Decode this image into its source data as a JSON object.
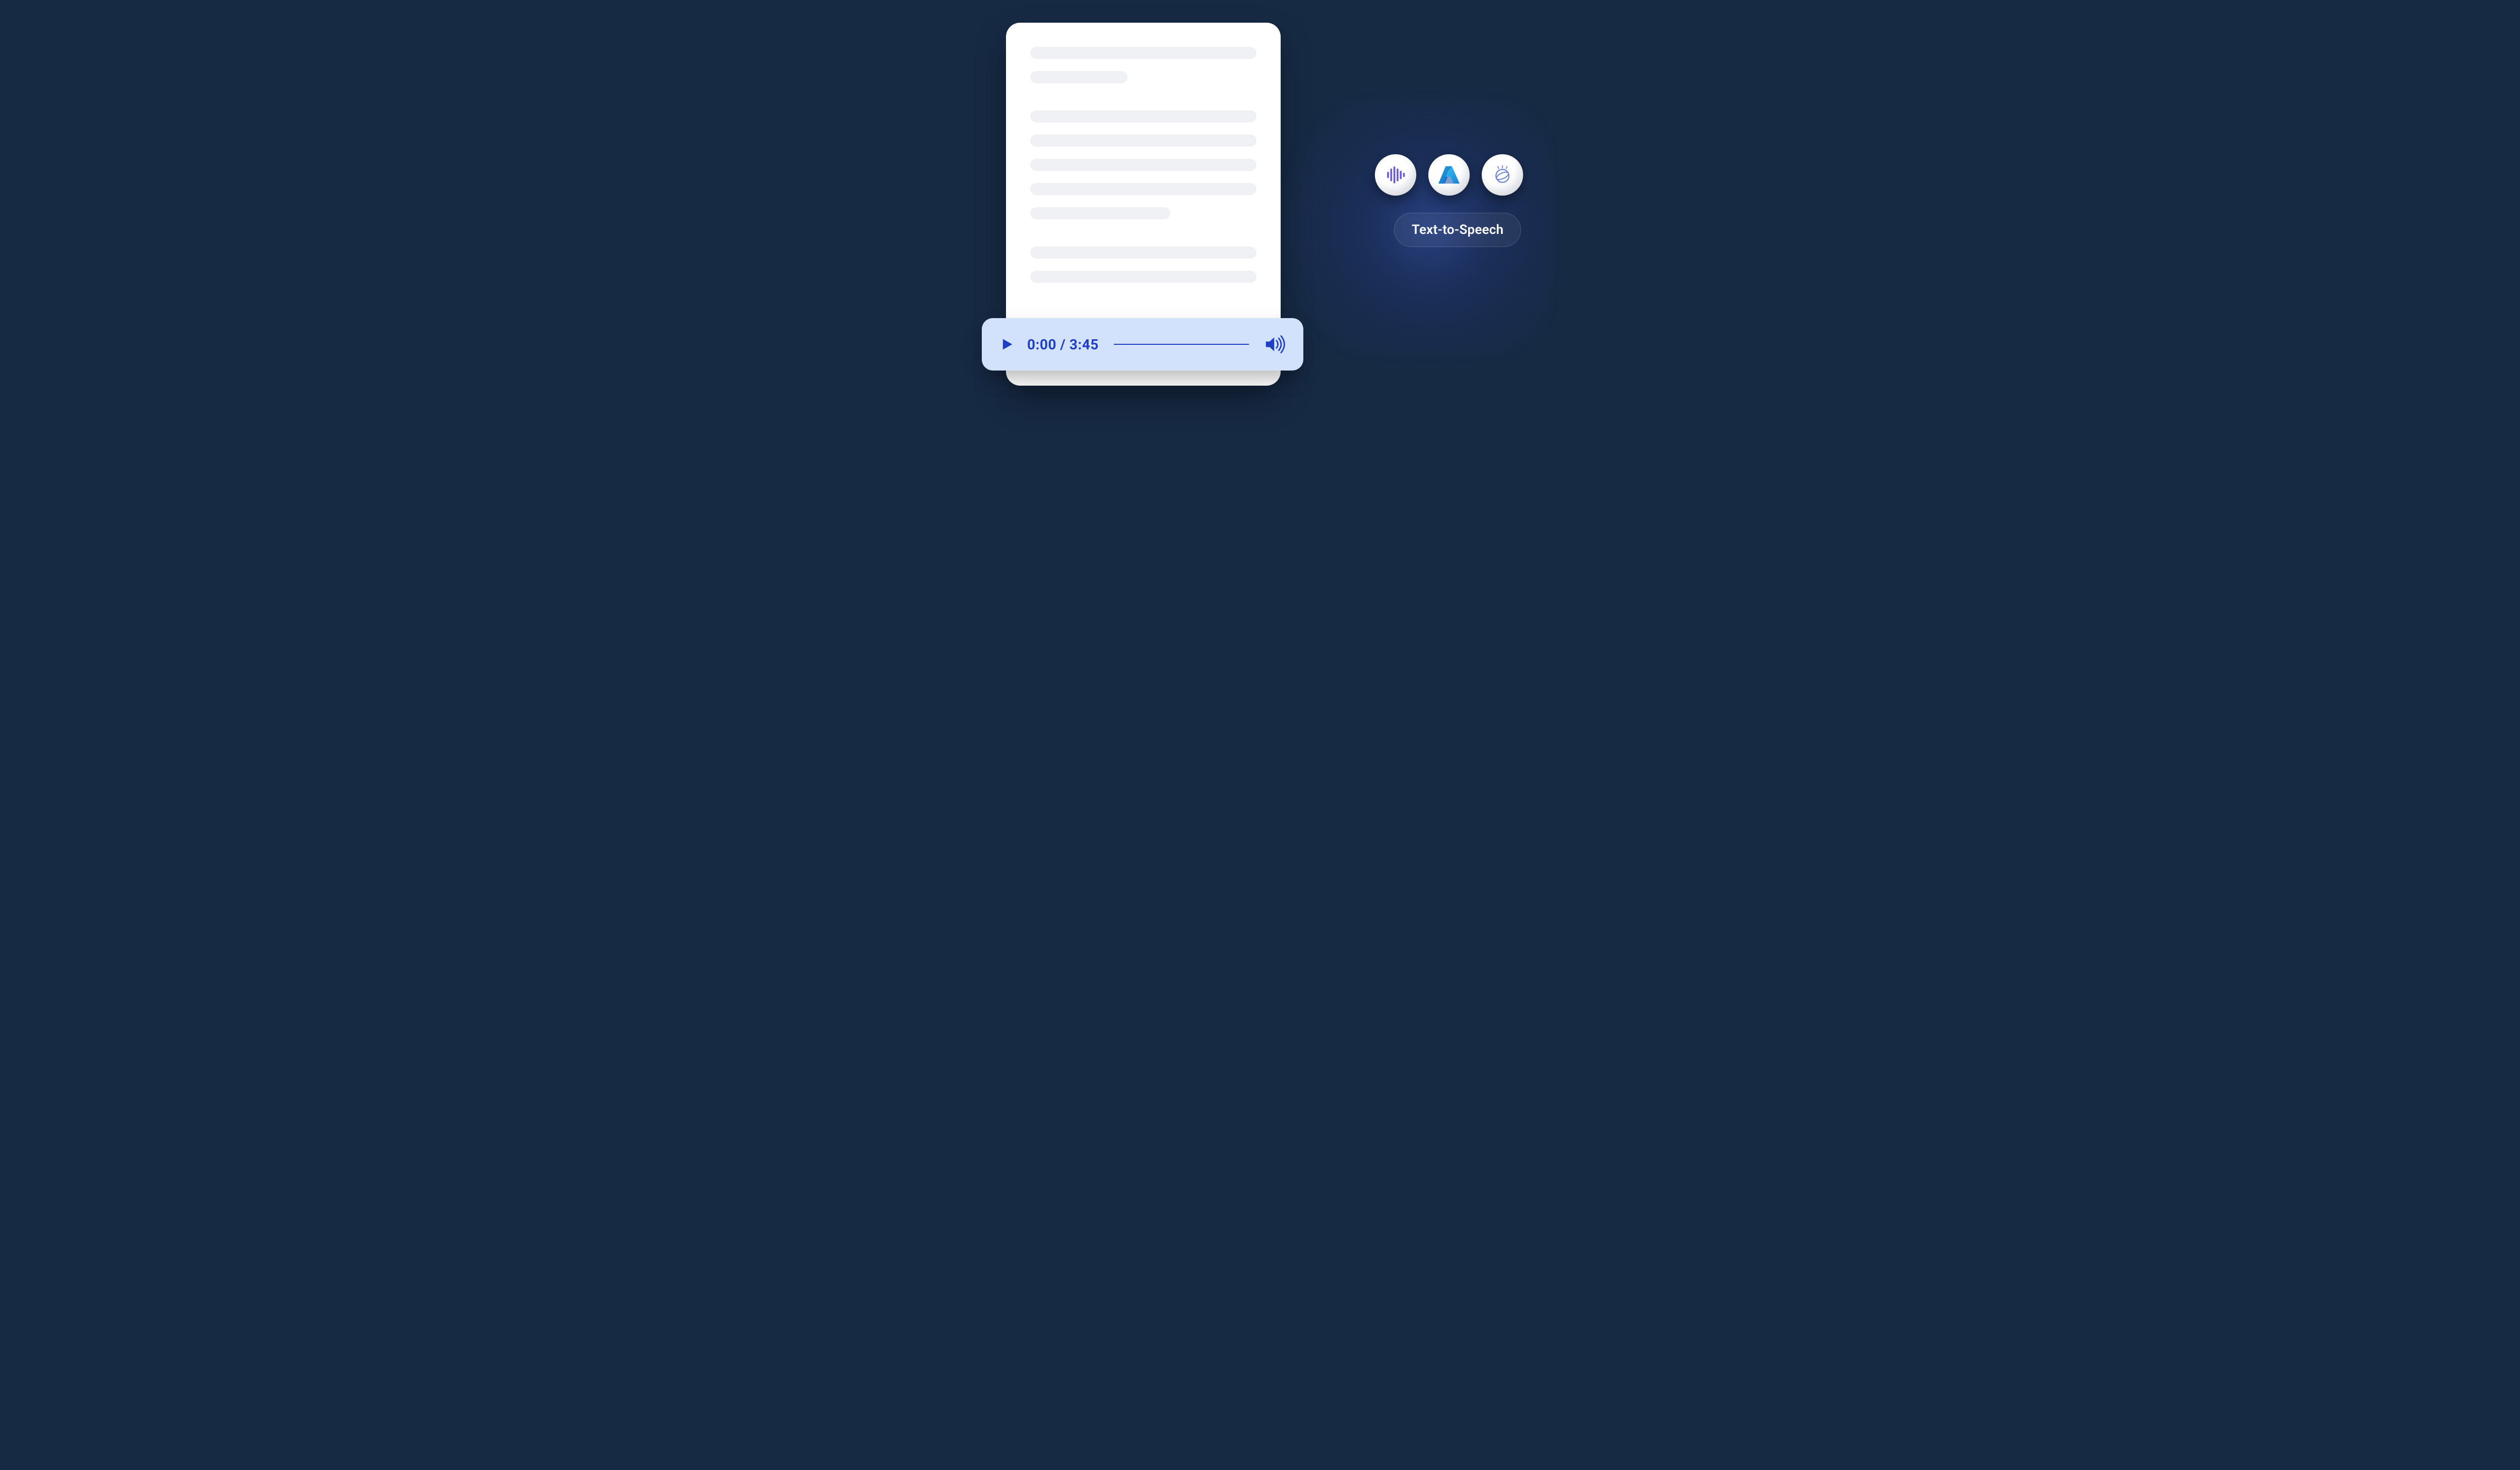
{
  "badge": {
    "label": "Text-to-Speech"
  },
  "player": {
    "current_time": "0:00",
    "separator": " / ",
    "total_time": "3:45"
  },
  "services": [
    {
      "name": "waveform-icon"
    },
    {
      "name": "azure-icon"
    },
    {
      "name": "watson-icon"
    }
  ],
  "document": {
    "paragraphs": [
      {
        "lines": [
          100,
          43
        ]
      },
      {
        "lines": [
          100,
          100,
          100,
          100,
          62
        ]
      },
      {
        "lines": [
          100,
          100
        ]
      }
    ]
  },
  "colors": {
    "bg": "#172a44",
    "player_bg": "#d3e2fc",
    "player_fg": "#1e3ec3",
    "doc_line": "#f0f1f4"
  }
}
